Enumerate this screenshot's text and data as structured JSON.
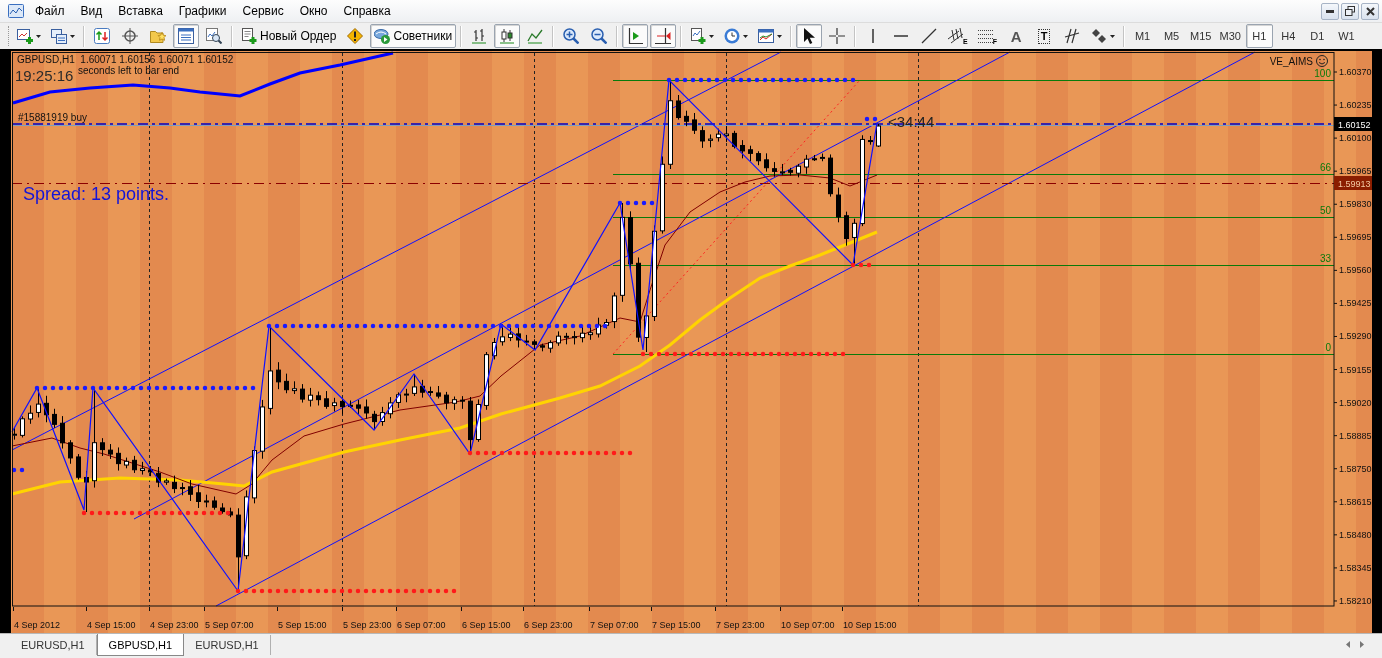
{
  "menu_bar": {
    "items": [
      "Файл",
      "Вид",
      "Вставка",
      "Графики",
      "Сервис",
      "Окно",
      "Справка"
    ]
  },
  "toolbar": {
    "groups": [
      {
        "items": [
          {
            "kind": "newchart",
            "selected": false
          },
          {
            "kind": "profiles",
            "selected": false
          }
        ]
      },
      {
        "items": [
          {
            "kind": "market",
            "selected": false
          },
          {
            "kind": "navigator",
            "selected": false
          },
          {
            "kind": "favorites",
            "selected": false
          },
          {
            "kind": "terminal",
            "selected": true
          },
          {
            "kind": "tester",
            "selected": false
          }
        ]
      },
      {
        "items": [
          {
            "kind": "order",
            "label": "Новый Ордер",
            "selected": false
          },
          {
            "kind": "autotrading",
            "selected": false
          },
          {
            "kind": "experts",
            "label": "Советники",
            "selected": true
          }
        ]
      },
      {
        "items": [
          {
            "kind": "bars",
            "selected": false
          },
          {
            "kind": "candles",
            "selected": true
          },
          {
            "kind": "line",
            "selected": false
          }
        ]
      },
      {
        "items": [
          {
            "kind": "zoomin",
            "selected": false
          },
          {
            "kind": "zoomout",
            "selected": false
          }
        ]
      },
      {
        "items": [
          {
            "kind": "autoscroll",
            "selected": true
          },
          {
            "kind": "shift",
            "selected": true
          }
        ]
      },
      {
        "items": [
          {
            "kind": "indicators",
            "selected": false
          },
          {
            "kind": "periods",
            "selected": false
          },
          {
            "kind": "templates",
            "selected": false
          }
        ]
      },
      {
        "items": [
          {
            "kind": "cursor",
            "selected": true
          },
          {
            "kind": "crosshair",
            "selected": false
          }
        ]
      },
      {
        "items": [
          {
            "kind": "vline",
            "selected": false
          },
          {
            "kind": "hline",
            "selected": false
          },
          {
            "kind": "trendline",
            "selected": false
          },
          {
            "kind": "channel",
            "glyph": "E",
            "selected": false
          },
          {
            "kind": "fibo",
            "glyph": "F",
            "selected": false
          },
          {
            "kind": "text",
            "glyph": "A",
            "selected": false
          },
          {
            "kind": "label",
            "glyph": "T",
            "selected": false
          },
          {
            "kind": "arrows",
            "selected": false
          },
          {
            "kind": "shapes",
            "selected": false
          }
        ]
      },
      {
        "items": [
          {
            "kind": "period",
            "label": "M1",
            "selected": false
          },
          {
            "kind": "period",
            "label": "M5",
            "selected": false
          },
          {
            "kind": "period",
            "label": "M15",
            "selected": false
          },
          {
            "kind": "period",
            "label": "M30",
            "selected": false
          },
          {
            "kind": "period",
            "label": "H1",
            "selected": true
          },
          {
            "kind": "period",
            "label": "H4",
            "selected": false
          },
          {
            "kind": "period",
            "label": "D1",
            "selected": false
          },
          {
            "kind": "period",
            "label": "W1",
            "selected": false
          }
        ]
      }
    ]
  },
  "chart": {
    "header": "GBPUSD,H1  1.60071 1.60156 1.60071 1.60152",
    "clock": "19:25:16",
    "countdown": "seconds left to bar end",
    "order_label": "#15881919 buy",
    "spread": "Spread: 13 points.",
    "indicator": "VE_AIMS",
    "timer": "<34:44",
    "fib_levels": [
      "100",
      "66",
      "50",
      "33",
      "0"
    ],
    "price_labels": [
      "1.60370",
      "1.60235",
      "1.60100",
      "1.59965",
      "1.59830",
      "1.59695",
      "1.59560",
      "1.59425",
      "1.59290",
      "1.59155",
      "1.59020",
      "1.58885",
      "1.58750",
      "1.58615",
      "1.58480",
      "1.58345",
      "1.58210"
    ],
    "price_markers": [
      {
        "kind": "order",
        "text": "1.60152"
      },
      {
        "kind": "bid",
        "text": "1.59913"
      }
    ],
    "time_labels": [
      "4 Sep 2012",
      "4 Sep 15:00",
      "4 Sep 23:00",
      "5 Sep 07:00",
      "5 Sep 15:00",
      "5 Sep 23:00",
      "6 Sep 07:00",
      "6 Sep 15:00",
      "6 Sep 23:00",
      "7 Sep 07:00",
      "7 Sep 15:00",
      "7 Sep 23:00",
      "10 Sep 07:00",
      "10 Sep 15:00"
    ]
  },
  "tabs": [
    {
      "label": "EURUSD,H1",
      "selected": false
    },
    {
      "label": "GBPUSD,H1",
      "selected": true
    },
    {
      "label": "EURUSD,H1",
      "selected": false
    }
  ]
}
